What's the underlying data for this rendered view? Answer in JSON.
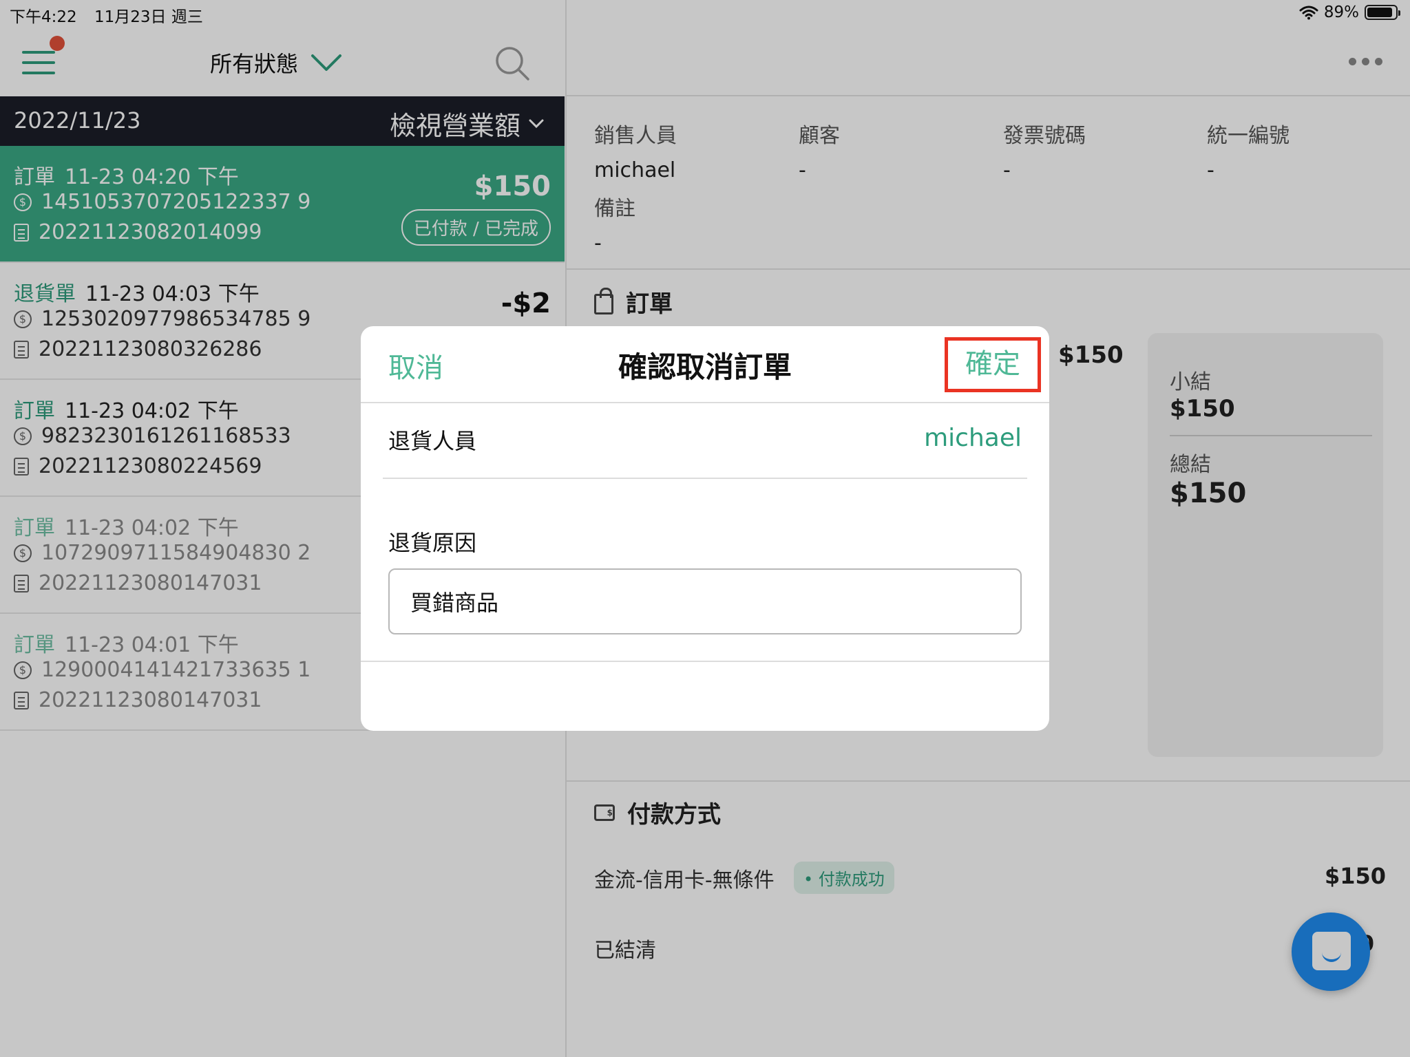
{
  "status_bar": {
    "time": "下午4:22",
    "date": "11月23日 週三",
    "battery": "89%",
    "battery_fraction": 0.89
  },
  "left": {
    "status_filter": "所有狀態",
    "date": "2022/11/23",
    "revenue_label": "檢視營業額",
    "orders": [
      {
        "kind": "訂單",
        "time": "11-23 04:20 下午",
        "payment_no": "1451053707205122337 9",
        "receipt_no": "20221123082014099",
        "amount": "$150",
        "status": "已付款 / 已完成"
      },
      {
        "kind": "退貨單",
        "time": "11-23 04:03 下午",
        "payment_no": "1253020977986534785 9",
        "receipt_no": "20221123080326286",
        "amount": "-$2"
      },
      {
        "kind": "訂單",
        "time": "11-23 04:02 下午",
        "payment_no": "9823230161261168533",
        "receipt_no": "20221123080224569"
      },
      {
        "kind": "訂單",
        "time": "11-23 04:02 下午",
        "payment_no": "1072909711584904830 2",
        "receipt_no": "20221123080147031"
      },
      {
        "kind": "訂單",
        "time": "11-23 04:01 下午",
        "payment_no": "1290004141421733635 1",
        "receipt_no": "20221123080147031"
      }
    ]
  },
  "right": {
    "info": [
      {
        "label": "銷售人員",
        "value": "michael"
      },
      {
        "label": "顧客",
        "value": "-"
      },
      {
        "label": "發票號碼",
        "value": "-"
      },
      {
        "label": "統一編號",
        "value": "-"
      }
    ],
    "remark": {
      "label": "備註",
      "value": "-"
    },
    "order_section": "訂單",
    "item_price": "$150",
    "summary": {
      "subtotal_label": "小結",
      "subtotal": "$150",
      "total_label": "總結",
      "total": "$150"
    },
    "payment_section": "付款方式",
    "payment": {
      "method": "金流-信用卡-無條件",
      "tag": "• 付款成功",
      "amount": "$150"
    },
    "settled": {
      "label": "已結清",
      "amount": "0"
    }
  },
  "modal": {
    "cancel": "取消",
    "title": "確認取消訂單",
    "confirm": "確定",
    "staff_label": "退貨人員",
    "staff_value": "michael",
    "reason_label": "退貨原因",
    "reason_value": "買錯商品"
  }
}
